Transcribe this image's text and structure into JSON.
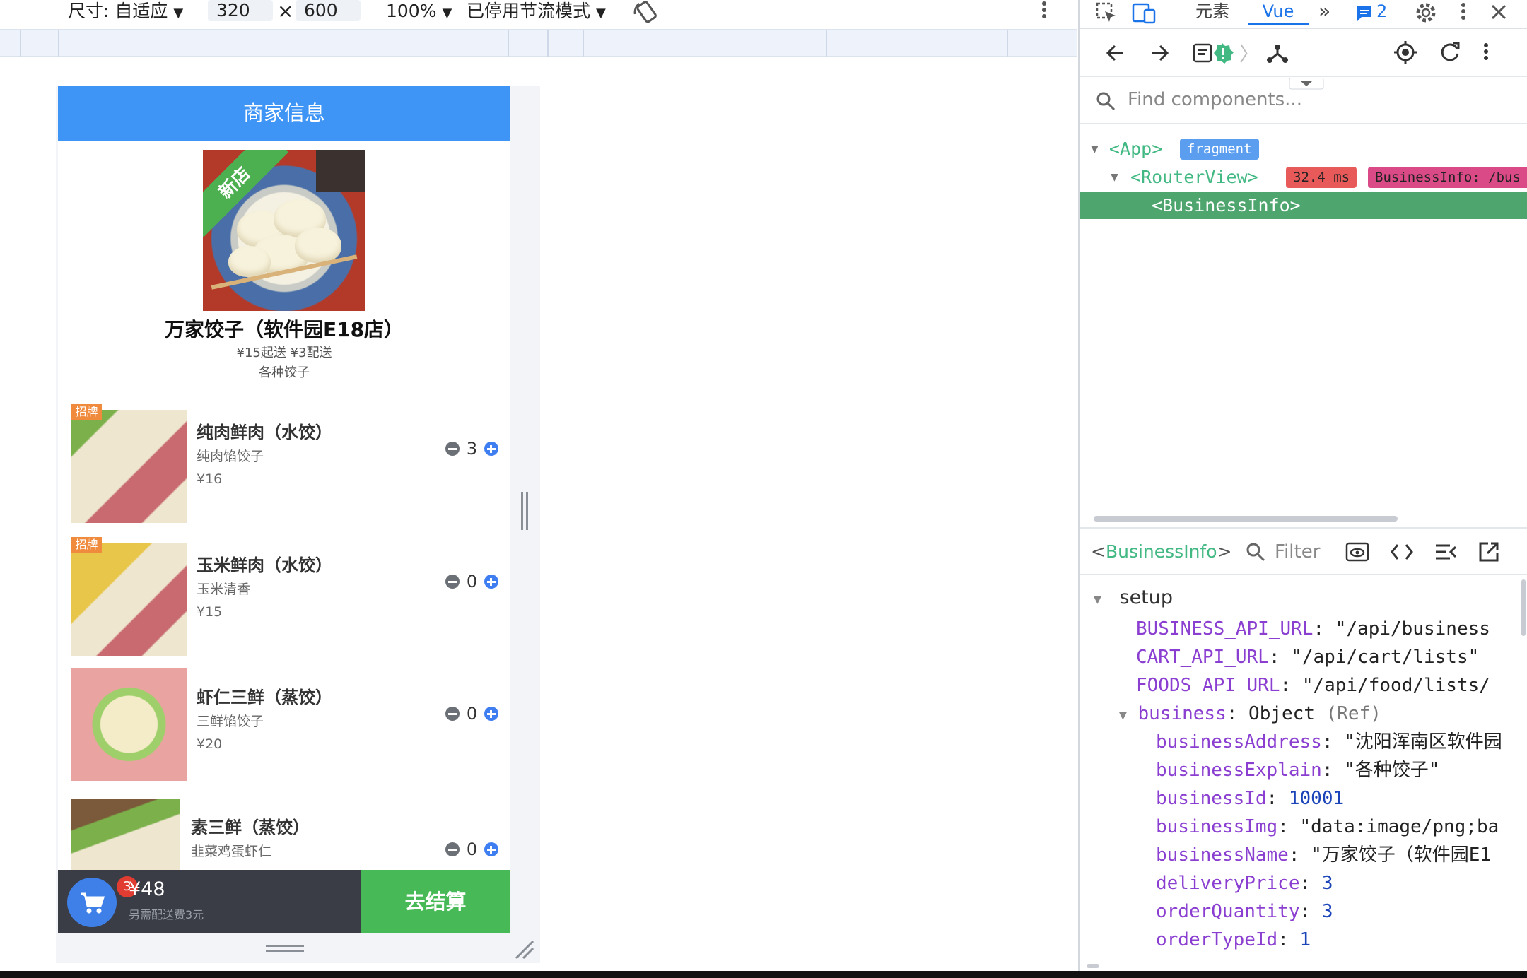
{
  "device_toolbar": {
    "size_label": "尺寸: 自适应",
    "width_value": "320",
    "times": "×",
    "height_value": "600",
    "zoom": "100%",
    "throttle": "已停用节流模式"
  },
  "app": {
    "header_title": "商家信息",
    "new_badge": "新店",
    "business_name": "万家饺子（软件园E18店）",
    "delivery_text": "¥15起送 ¥3配送",
    "explain": "各种饺子",
    "foods": [
      {
        "name": "纯肉鲜肉（水饺）",
        "desc": "纯肉馅饺子",
        "price": "¥16",
        "qty": "3",
        "badge": "招牌"
      },
      {
        "name": "玉米鲜肉（水饺）",
        "desc": "玉米清香",
        "price": "¥15",
        "qty": "0",
        "badge": "招牌"
      },
      {
        "name": "虾仁三鲜（蒸饺）",
        "desc": "三鲜馅饺子",
        "price": "¥20",
        "qty": "0",
        "badge": ""
      },
      {
        "name": "素三鲜（蒸饺）",
        "desc": "韭菜鸡蛋虾仁",
        "price": "",
        "qty": "0",
        "badge": ""
      }
    ],
    "cart": {
      "count": "3",
      "total": "¥48",
      "tip": "另需配送费3元",
      "checkout": "去结算"
    }
  },
  "devtools": {
    "tabs": {
      "elements": "元素",
      "vue": "Vue",
      "messages_count": "2"
    },
    "search_placeholder": "Find components...",
    "tree": {
      "app": "<App>",
      "fragment": "fragment",
      "router_view": "<RouterView>",
      "timing": "32.4 ms",
      "route_pill": "BusinessInfo: /bus",
      "business_info": "<BusinessInfo>"
    },
    "inspector": {
      "component": "BusinessInfo",
      "filter_placeholder": "Filter",
      "section": "setup",
      "props": [
        {
          "k": "BUSINESS_API_URL",
          "v": "\"/api/business"
        },
        {
          "k": "CART_API_URL",
          "v": "\"/api/cart/lists\""
        },
        {
          "k": "FOODS_API_URL",
          "v": "\"/api/food/lists/"
        }
      ],
      "business_key": "business",
      "business_type": "Object",
      "business_ref": "(Ref)",
      "business_props": [
        {
          "k": "businessAddress",
          "v": "\"沈阳浑南区软件园"
        },
        {
          "k": "businessExplain",
          "v": "\"各种饺子\""
        },
        {
          "k": "businessId",
          "v": "10001"
        },
        {
          "k": "businessImg",
          "v": "\"data:image/png;ba"
        },
        {
          "k": "businessName",
          "v": "\"万家饺子（软件园E1"
        },
        {
          "k": "deliveryPrice",
          "v": "3"
        },
        {
          "k": "orderQuantity",
          "v": "3"
        },
        {
          "k": "orderTypeId",
          "v": "1"
        }
      ]
    }
  },
  "colors": {
    "brand_blue": "#3f95f5",
    "checkout_green": "#47ba57",
    "vue_green": "#42b883",
    "selected_row": "#4ea56d"
  }
}
